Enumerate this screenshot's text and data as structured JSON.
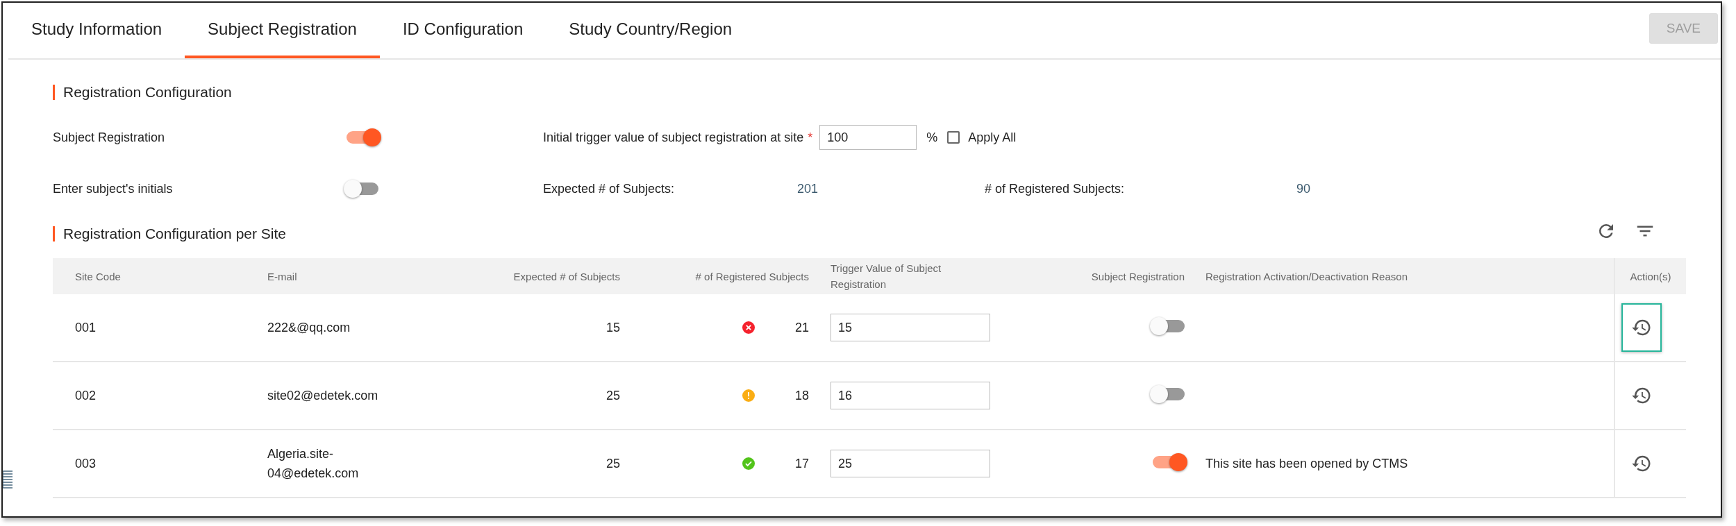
{
  "tabs": [
    {
      "label": "Study Information",
      "selected": false
    },
    {
      "label": "Subject Registration",
      "selected": true
    },
    {
      "label": "ID Configuration",
      "selected": false
    },
    {
      "label": "Study Country/Region",
      "selected": false
    }
  ],
  "save_button": {
    "label": "SAVE",
    "disabled": true
  },
  "registration_configuration": {
    "title": "Registration Configuration",
    "subject_registration": {
      "label": "Subject Registration",
      "on": true
    },
    "enter_initials": {
      "label": "Enter subject's initials",
      "on": false
    },
    "initial_trigger": {
      "label": "Initial trigger value of subject registration at site",
      "required_mark": "*",
      "value": "100",
      "unit": "%"
    },
    "apply_all": {
      "label": "Apply All",
      "checked": false
    },
    "expected_subjects": {
      "label": "Expected # of Subjects:",
      "value": "201"
    },
    "registered_subjects": {
      "label": "# of Registered Subjects:",
      "value": "90"
    }
  },
  "site_table": {
    "title": "Registration Configuration per Site",
    "columns": [
      "Site Code",
      "E-mail",
      "Expected # of Subjects",
      "# of Registered Subjects",
      "Trigger Value of Subject Registration",
      "Subject Registration",
      "Registration Activation/Deactivation Reason",
      "Action(s)"
    ],
    "rows": [
      {
        "site_code": "001",
        "email": "222&@qq.com",
        "expected": "15",
        "kind": "error",
        "registered": "21",
        "trigger_value": "15",
        "subject_registration": false,
        "focused": true
      },
      {
        "site_code": "002",
        "email": "site02@edetek.com",
        "expected": "25",
        "kind": "warning",
        "registered": "18",
        "trigger_value": "16",
        "subject_registration": false,
        "focused": false
      },
      {
        "site_code": "003",
        "email": "Algeria.site-04@edetek.com",
        "expected": "25",
        "kind": "success",
        "registered": "17",
        "trigger_value": "25",
        "subject_registration": true,
        "reason": "This site has been opened by CTMS",
        "focused": false
      }
    ]
  }
}
